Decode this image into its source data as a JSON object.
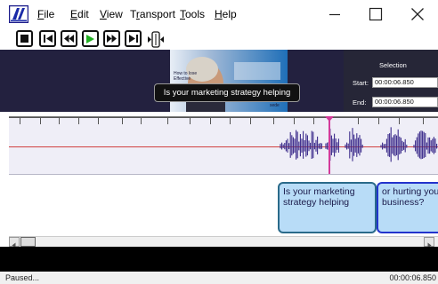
{
  "menu": {
    "file": {
      "u": "F",
      "rest": "ile"
    },
    "edit": {
      "u": "E",
      "rest": "dit"
    },
    "view": {
      "u": "V",
      "rest": "iew"
    },
    "transport": {
      "pre": "T",
      "u": "r",
      "rest": "ansport"
    },
    "tools": {
      "u": "T",
      "rest": "ools"
    },
    "help": {
      "u": "H",
      "rest": "elp"
    }
  },
  "icons": {
    "logo": "subtitle-edit-logo",
    "minimize": "minimize-icon",
    "maximize": "maximize-icon",
    "close": "close-icon",
    "stop": "stop-icon",
    "first": "skip-to-start-icon",
    "rewind": "rewind-icon",
    "play": "play-icon",
    "forward": "fast-forward-icon",
    "last": "skip-to-end-icon",
    "fit": "fit-waveform-icon"
  },
  "colors": {
    "play": "#22b022",
    "playhead": "#d33a9a",
    "wave": "#3a2a8a",
    "subtitle_fill": "#b8dcf7"
  },
  "video": {
    "frame_text": [
      "How to lose",
      "Effective"
    ],
    "frame_logo": "sede"
  },
  "selection": {
    "title": "Selection",
    "start_label": "Start:",
    "start_value": "00:00:06.850",
    "end_label": "End:",
    "end_value": "00:00:06.850"
  },
  "tooltip": "Is your marketing strategy helping",
  "subtitles": [
    {
      "text": "Is your marketing strategy helping"
    },
    {
      "text": "or hurting your business?"
    }
  ],
  "status": {
    "left": "Paused...",
    "right": "00:00:06.850"
  }
}
